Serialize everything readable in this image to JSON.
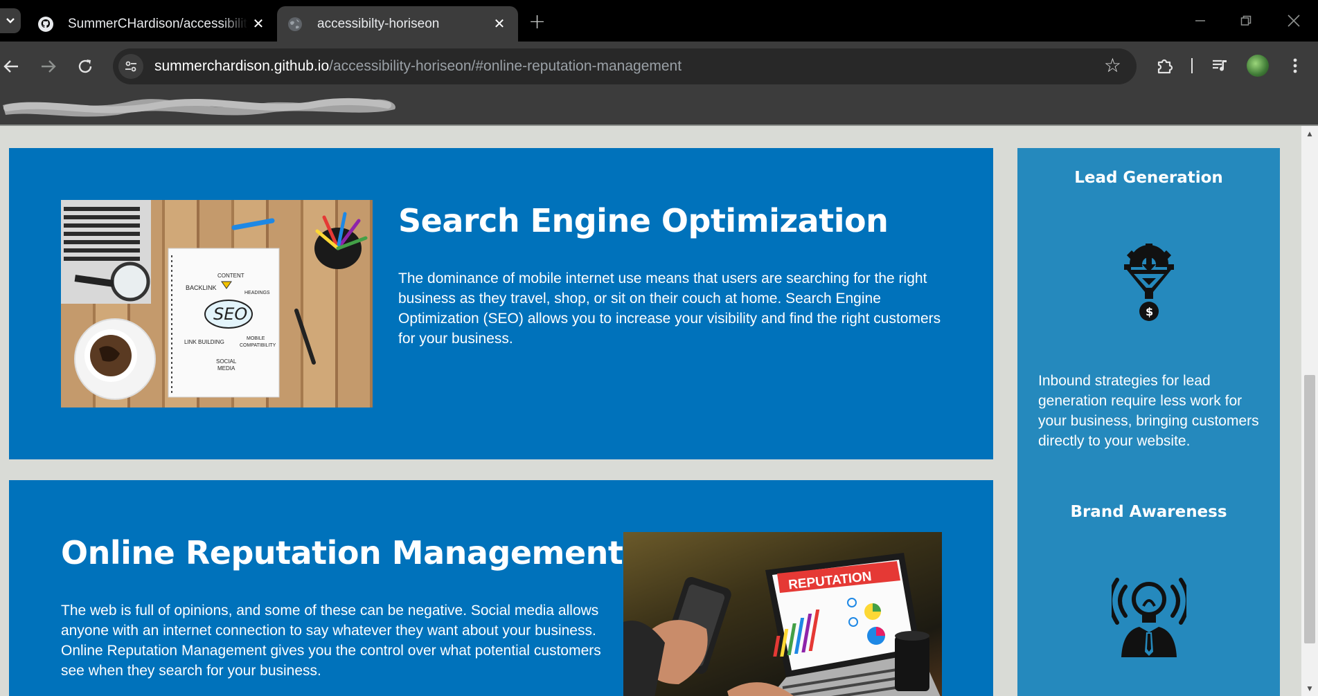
{
  "browser": {
    "tabs": [
      {
        "title": "SummerCHardison/accessibility",
        "favicon": "github-icon",
        "active": false
      },
      {
        "title": "accessibilty-horiseon",
        "favicon": "globe-icon",
        "active": true
      }
    ],
    "new_tab": "+",
    "address_bar": {
      "host": "summerchardison.github.io",
      "path": "/accessibility-horiseon/#online-reputation-management"
    }
  },
  "main": {
    "seo": {
      "heading": "Search Engine Optimization",
      "text": "The dominance of mobile internet use means that users are searching for the right business as they travel, shop, or sit on their couch at home. Search Engine Optimization (SEO) allows you to increase your visibility and find the right customers for your business.",
      "image": {
        "words": {
          "content": "CONTENT",
          "backlink": "BACKLINK",
          "headings": "HEADINGS",
          "seo": "SEO",
          "link_building": "LINK BUILDING",
          "mobile": "MOBILE",
          "compatibility": "COMPATIBILITY",
          "social": "SOCIAL",
          "media": "MEDIA"
        }
      }
    },
    "orm": {
      "heading": "Online Reputation Management",
      "text": "The web is full of opinions, and some of these can be negative. Social media allows anyone with an internet connection to say whatever they want about your business. Online Reputation Management gives you the control over what potential customers see when they search for your business.",
      "image": {
        "banner": "REPUTATION"
      }
    }
  },
  "sidebar": {
    "lead_generation": {
      "heading": "Lead Generation",
      "icon": "lead-generation-icon",
      "text": "Inbound strategies for lead generation require less work for your business, bringing customers directly to your website."
    },
    "brand_awareness": {
      "heading": "Brand Awareness",
      "icon": "brand-awareness-icon"
    }
  },
  "colors": {
    "card_blue": "#0072bb",
    "aside_blue": "#2589bd",
    "page_bg": "#d9dbd6",
    "chrome_dark": "#3c3c3c"
  }
}
